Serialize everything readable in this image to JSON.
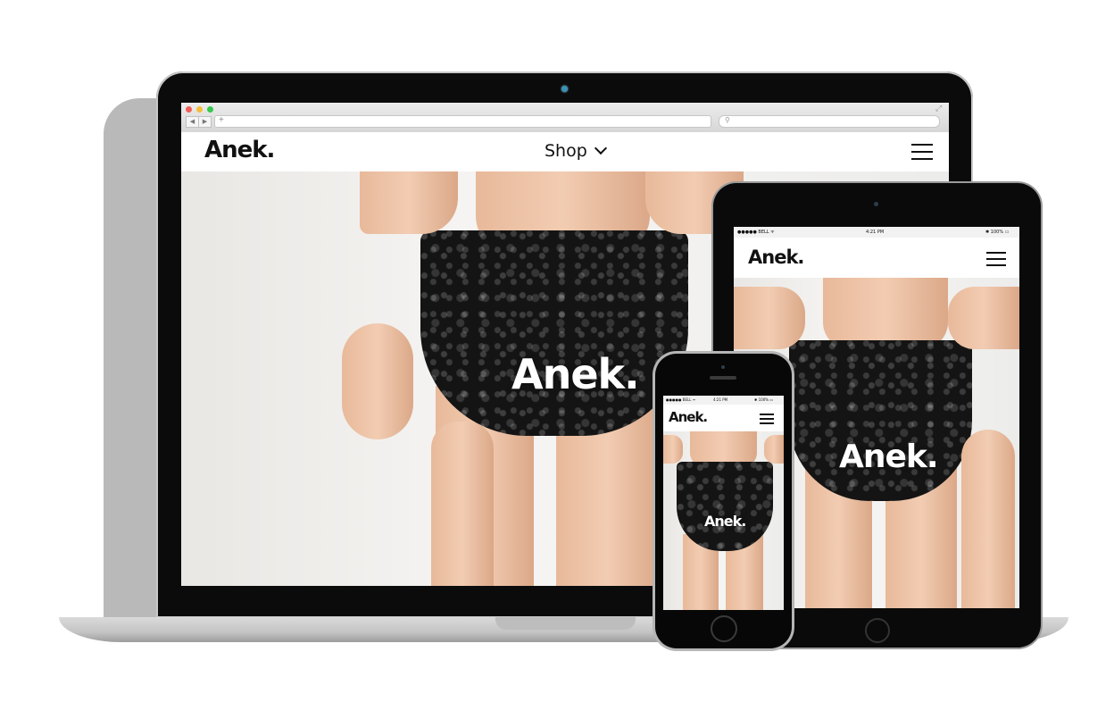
{
  "brand": "Anek.",
  "desktop": {
    "nav_menu_label": "Shop",
    "hero_wordmark": "Anek."
  },
  "tablet": {
    "status": {
      "carrier": "●●●●● BELL ᯤ",
      "time": "4:21 PM",
      "battery": "✱ 100% ▭"
    },
    "hero_wordmark": "Anek."
  },
  "phone": {
    "status": {
      "carrier": "●●●●● BELL ᯤ",
      "time": "4:21 PM",
      "battery": "✱ 100% ▭"
    },
    "hero_wordmark": "Anek."
  },
  "colors": {
    "accent_black": "#111111",
    "window_close": "#f35d56",
    "window_minimize": "#f5be3a",
    "window_zoom": "#36c84b"
  },
  "icons": [
    "menu-icon",
    "chevron-down-icon",
    "search-icon",
    "back-icon",
    "forward-icon",
    "fullscreen-icon",
    "new-tab-icon"
  ]
}
